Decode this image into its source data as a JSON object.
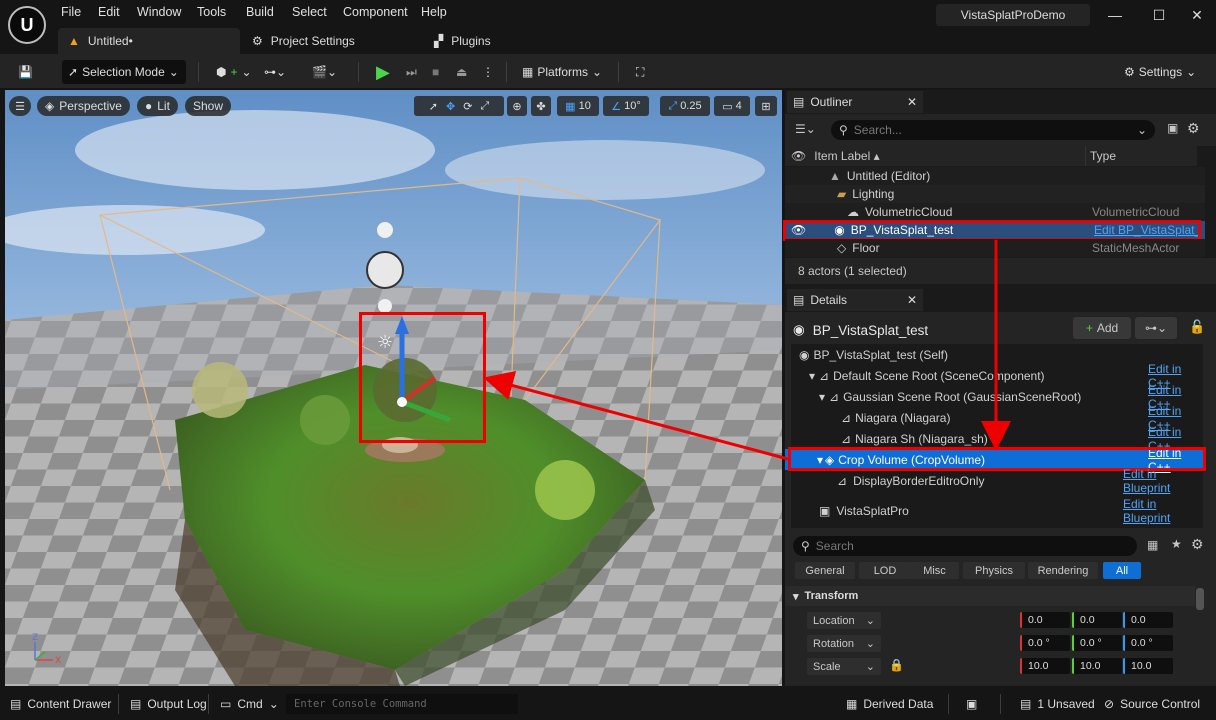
{
  "app": {
    "logo": "U",
    "menu": [
      "File",
      "Edit",
      "Window",
      "Tools",
      "Build",
      "Select",
      "Component",
      "Help"
    ],
    "project_name": "VistaSplatProDemo",
    "tabs": [
      {
        "label": "Untitled•",
        "icon": "level-icon"
      },
      {
        "label": "Project Settings",
        "icon": "settings-icon"
      },
      {
        "label": "Plugins",
        "icon": "plugin-icon"
      }
    ]
  },
  "toolbar": {
    "selection_mode": "Selection Mode",
    "platforms": "Platforms",
    "settings": "Settings"
  },
  "viewport": {
    "perspective": "Perspective",
    "lit": "Lit",
    "show": "Show",
    "grid_snap": "10",
    "rotation_snap": "10°",
    "scale_snap": "0.25",
    "camera_speed": "4"
  },
  "outliner": {
    "tab": "Outliner",
    "search_placeholder": "Search...",
    "col_label": "Item Label ▴",
    "col_type": "Type",
    "rows": [
      {
        "label": "Untitled (Editor)",
        "type": ""
      },
      {
        "label": "Lighting",
        "type": ""
      },
      {
        "label": "VolumetricCloud",
        "type": "VolumetricCloud"
      },
      {
        "label": "BP_VistaSplat_test",
        "type": "Edit BP_VistaSplat_te"
      },
      {
        "label": "Floor",
        "type": "StaticMeshActor"
      }
    ],
    "footer": "8 actors (1 selected)"
  },
  "details": {
    "tab": "Details",
    "actor": "BP_VistaSplat_test",
    "add": "Add",
    "components": [
      {
        "label": "BP_VistaSplat_test (Self)",
        "action": ""
      },
      {
        "label": "Default Scene Root (SceneComponent)",
        "action": "Edit in C++"
      },
      {
        "label": "Gaussian Scene Root (GaussianSceneRoot)",
        "action": "Edit in C++"
      },
      {
        "label": "Niagara (Niagara)",
        "action": "Edit in C++"
      },
      {
        "label": "Niagara Sh (Niagara_sh)",
        "action": "Edit in C++"
      },
      {
        "label": "Crop Volume (CropVolume)",
        "action": "Edit in C++"
      },
      {
        "label": "DisplayBorderEditroOnly",
        "action": "Edit in Blueprint"
      }
    ],
    "vista": {
      "label": "VistaSplatPro",
      "action": "Edit in Blueprint"
    },
    "search_placeholder": "Search",
    "filters": [
      "General",
      "LOD",
      "Misc",
      "Physics",
      "Rendering",
      "All"
    ],
    "section": "Transform",
    "transform": [
      {
        "label": "Location",
        "x": "0.0",
        "y": "0.0",
        "z": "0.0"
      },
      {
        "label": "Rotation",
        "x": "0.0 °",
        "y": "0.0 °",
        "z": "0.0 °"
      },
      {
        "label": "Scale",
        "x": "10.0",
        "y": "10.0",
        "z": "10.0"
      }
    ]
  },
  "status": {
    "content_drawer": "Content Drawer",
    "output_log": "Output Log",
    "cmd": "Cmd",
    "console_placeholder": "Enter Console Command",
    "derived_data": "Derived Data",
    "unsaved": "1 Unsaved",
    "source_control": "Source Control"
  },
  "colors": {
    "accent": "#0d6fd6",
    "highlight": "#e00000",
    "selected_row": "#0d6fd6"
  }
}
